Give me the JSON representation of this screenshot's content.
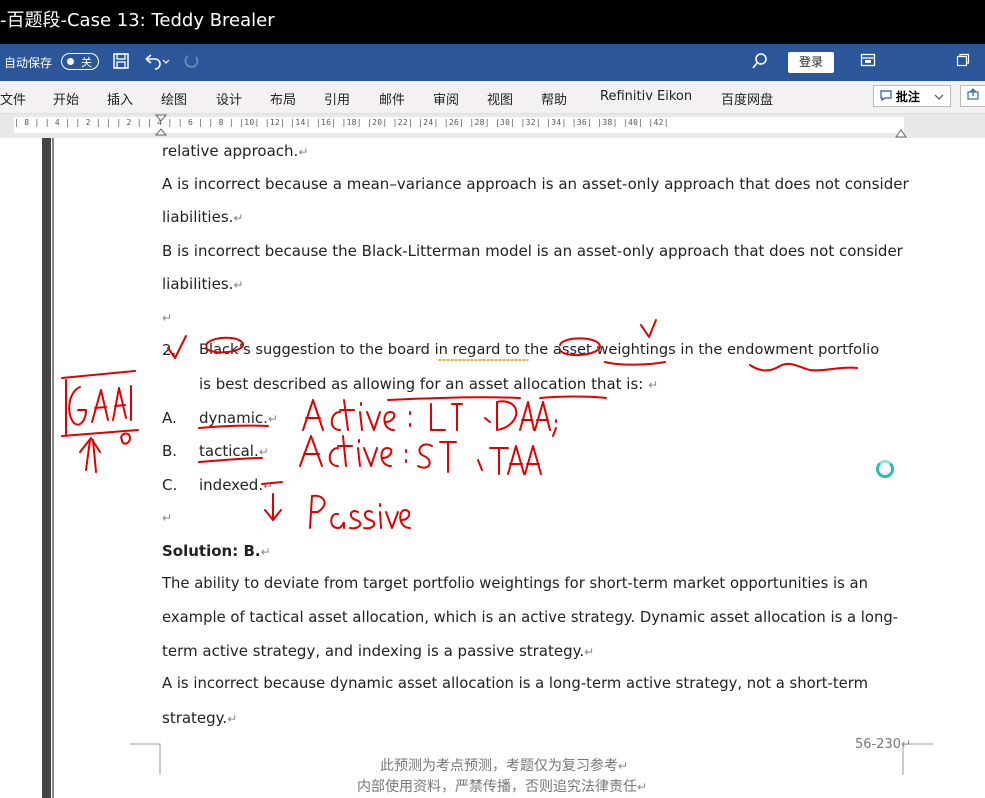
{
  "window": {
    "title": "-百题段-Case 13: Teddy Brealer"
  },
  "qat": {
    "autosave_label": "自动保存",
    "autosave_state": "关",
    "login_label": "登录",
    "icons": [
      "save-icon",
      "undo-icon",
      "redo-icon",
      "search-icon",
      "ribbon-display-icon",
      "restore-window-icon"
    ]
  },
  "menu": {
    "items": [
      "文件",
      "开始",
      "插入",
      "绘图",
      "设计",
      "布局",
      "引用",
      "邮件",
      "审阅",
      "视图",
      "帮助",
      "Refinitiv Eikon",
      "百度网盘"
    ],
    "comment_label": "批注"
  },
  "ruler": {
    "text": "| 8 |  | 4 |  | 2 |  |  | 2 |  | 4 |  | 6 |  | 8 |  |10|  |12|  |14|  |16|  |18|  |20|  |22|  |24|  |26|  |28|  |30|  |32|  |34|  |36|  |38|  |40|  |42|"
  },
  "document": {
    "lines": [
      "relative approach.",
      "A is incorrect because a mean–variance approach is an asset-only approach that does not consider",
      "liabilities.",
      "B is incorrect because the Black-Litterman model is an asset-only approach that does not consider",
      "liabilities."
    ],
    "question_number": "2.",
    "question_line1": "Black’s suggestion to the board in regard to the asset weightings in the endowment portfolio",
    "question_line2": "is best described as allowing for an asset allocation that is:",
    "options": [
      {
        "letter": "A.",
        "text": "dynamic."
      },
      {
        "letter": "B.",
        "text": "tactical."
      },
      {
        "letter": "C.",
        "text": "indexed."
      }
    ],
    "solution_label": "Solution: B.",
    "solution_lines": [
      "The ability to deviate from target portfolio weightings for short-term market opportunities is an",
      "example of tactical asset allocation, which is an active strategy. Dynamic asset allocation is a long-",
      "term active strategy, and indexing is a passive strategy.",
      "A is incorrect because dynamic asset allocation is a long-term active strategy, not a short-term",
      "strategy."
    ],
    "paragraph_mark": "↵"
  },
  "footer": {
    "page_number": "56-230",
    "line1": "此预测为考点预测，考题仅为复习参考",
    "line2": "内部使用资料，严禁传播，否则追究法律责任"
  },
  "annotations": {
    "handwriting": [
      "GAA",
      "Active : LT , DAA;",
      "Active : ST , TAA",
      "Passive"
    ],
    "ink_color": "#e00000"
  }
}
